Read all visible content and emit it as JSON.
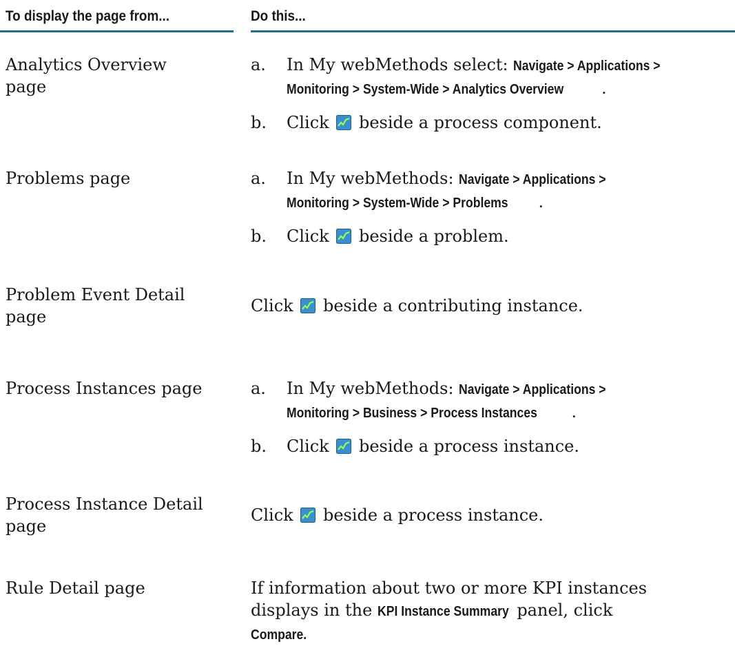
{
  "header": {
    "col1": "To display the page from...",
    "col2": "Do this..."
  },
  "icon": "chart-icon",
  "rows": [
    {
      "page_line1": "Analytics Overview",
      "page_line2": "page",
      "step_a_letter": "a.",
      "step_a_prefix": "In My webMethods select:",
      "step_a_nav1": "Navigate > Applications >",
      "step_a_nav2": "Monitoring > System-Wide > Analytics Overview",
      "step_a_end": ".",
      "step_b_letter": "b.",
      "step_b_before": "Click",
      "step_b_after": "beside a process component."
    },
    {
      "page_line1": "Problems page",
      "step_a_letter": "a.",
      "step_a_prefix": "In My webMethods:",
      "step_a_nav1": "Navigate > Applications >",
      "step_a_nav2": "Monitoring > System-Wide > Problems",
      "step_a_end": ".",
      "step_b_letter": "b.",
      "step_b_before": "Click",
      "step_b_after": "beside a problem."
    },
    {
      "page_line1": "Problem Event Detail",
      "page_line2": "page",
      "text_before": "Click",
      "text_after": "beside a contributing instance."
    },
    {
      "page_line1": "Process Instances page",
      "step_a_letter": "a.",
      "step_a_prefix": "In My webMethods:",
      "step_a_nav1": "Navigate > Applications >",
      "step_a_nav2": "Monitoring > Business > Process Instances",
      "step_a_end": ".",
      "step_b_letter": "b.",
      "step_b_before": "Click",
      "step_b_after": "beside a process instance."
    },
    {
      "page_line1": "Process Instance Detail",
      "page_line2": "page",
      "text_before": "Click",
      "text_after": "beside a process instance."
    },
    {
      "page_line1": "Rule Detail page",
      "line1": "If information about two or more KPI instances",
      "line2_before": "displays in the",
      "line2_bold": "KPI Instance Summary",
      "line2_after": "panel, click",
      "line3_bold": "Compare."
    }
  ]
}
